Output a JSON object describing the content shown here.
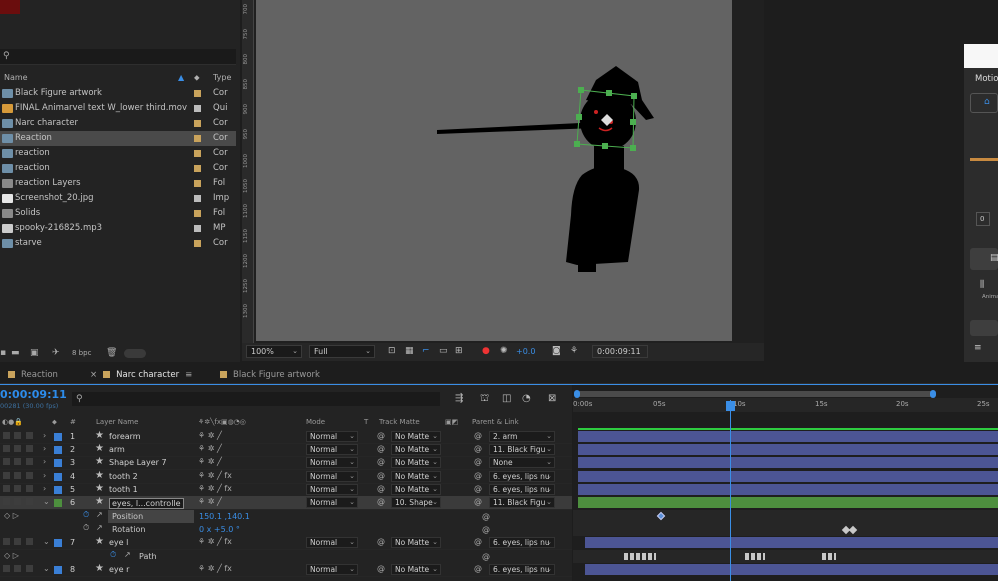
{
  "project": {
    "columns": {
      "name": "Name",
      "type": "Type"
    },
    "items": [
      {
        "name": "Black Figure artwork",
        "type": "Cor",
        "icon": "comp-icon",
        "label_color": "#c9a35c"
      },
      {
        "name": "FINAL Animarvel text W_lower third.mov",
        "type": "Qui",
        "icon": "movie-icon",
        "label_color": "#bcbcbc"
      },
      {
        "name": "Narc character",
        "type": "Cor",
        "icon": "comp-icon",
        "label_color": "#c9a35c"
      },
      {
        "name": "Reaction",
        "type": "Cor",
        "icon": "comp-icon",
        "label_color": "#c9a35c",
        "selected": true
      },
      {
        "name": "reaction",
        "type": "Cor",
        "icon": "comp-icon",
        "label_color": "#c9a35c"
      },
      {
        "name": "reaction",
        "type": "Cor",
        "icon": "comp-icon",
        "label_color": "#c9a35c"
      },
      {
        "name": "reaction Layers",
        "type": "Fol",
        "icon": "folder-icon",
        "label_color": "#c9a35c"
      },
      {
        "name": "Screenshot_20.jpg",
        "type": "Imp",
        "icon": "image-icon",
        "label_color": "#bcbcbc"
      },
      {
        "name": "Solids",
        "type": "Fol",
        "icon": "folder-icon",
        "label_color": "#c9a35c"
      },
      {
        "name": "spooky-216825.mp3",
        "type": "MP",
        "icon": "audio-icon",
        "label_color": "#bcbcbc"
      },
      {
        "name": "starve",
        "type": "Cor",
        "icon": "comp-icon",
        "label_color": "#c9a35c"
      }
    ],
    "bpc": "8 bpc"
  },
  "viewer": {
    "ruler_ticks": [
      "700",
      "750",
      "800",
      "850",
      "900",
      "950",
      "1000",
      "1050",
      "1100",
      "1150",
      "1200",
      "1250",
      "1300"
    ],
    "zoom": "100%",
    "resolution": "Full",
    "exposure": "+0.0",
    "timecode": "0:00:09:11"
  },
  "right_panel": {
    "label": "Motio"
  },
  "tabs": [
    {
      "label": "Reaction",
      "color": "#c9a35c",
      "active": false
    },
    {
      "label": "Narc character",
      "color": "#c9a35c",
      "active": true
    },
    {
      "label": "Black Figure artwork",
      "color": "#c9a35c",
      "active": false
    }
  ],
  "timeline": {
    "timecode": "0:00:09:11",
    "fps": "00281 (30.00 fps)",
    "columns": {
      "num": "#",
      "layer_name": "Layer Name",
      "mode": "Mode",
      "t": "T",
      "track_matte": "Track Matte",
      "parent": "Parent & Link"
    },
    "ruler": [
      "0:00s",
      "05s",
      "10s",
      "15s",
      "20s",
      "25s"
    ],
    "layers": [
      {
        "num": "1",
        "name": "forearm",
        "color": "#3a7fd6",
        "mode": "Normal",
        "matte": "No Matte",
        "parent": "2. arm",
        "fx": false
      },
      {
        "num": "2",
        "name": "arm",
        "color": "#3a7fd6",
        "mode": "Normal",
        "matte": "No Matte",
        "parent": "11. Black Figu",
        "fx": false
      },
      {
        "num": "3",
        "name": "Shape Layer 7",
        "color": "#3a7fd6",
        "mode": "Normal",
        "matte": "No Matte",
        "parent": "None",
        "fx": false
      },
      {
        "num": "4",
        "name": "tooth 2",
        "color": "#3a7fd6",
        "mode": "Normal",
        "matte": "No Matte",
        "parent": "6. eyes, lips nu",
        "fx": true
      },
      {
        "num": "5",
        "name": "tooth 1",
        "color": "#3a7fd6",
        "mode": "Normal",
        "matte": "No Matte",
        "parent": "6. eyes, lips nu",
        "fx": true
      },
      {
        "num": "6",
        "name": "eyes, l...controlle",
        "color": "#4d8f3e",
        "mode": "Normal",
        "matte": "10. Shape",
        "parent": "11. Black Figu",
        "fx": false,
        "selected": true
      },
      {
        "num": "7",
        "name": "eye l",
        "color": "#3a7fd6",
        "mode": "Normal",
        "matte": "No Matte",
        "parent": "6. eyes, lips nu",
        "fx": true
      },
      {
        "num": "8",
        "name": "eye r",
        "color": "#3a7fd6",
        "mode": "Normal",
        "matte": "No Matte",
        "parent": "6. eyes, lips nu",
        "fx": true
      }
    ],
    "props": {
      "position": {
        "label": "Position",
        "value": "150.1 ,140.1"
      },
      "rotation": {
        "label": "Rotation",
        "value": "0 x +5.0 °"
      },
      "path": {
        "label": "Path"
      }
    }
  }
}
